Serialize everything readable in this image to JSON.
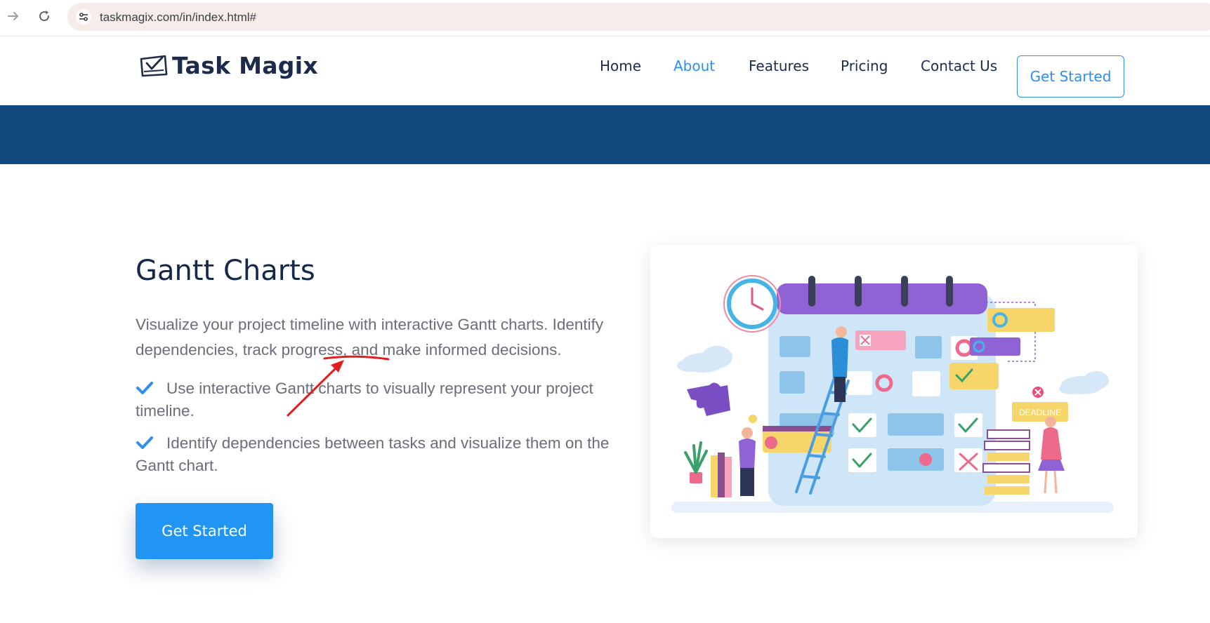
{
  "browser": {
    "url": "taskmagix.com/in/index.html#",
    "back_icon": "arrow-right-icon",
    "reload_icon": "reload-icon",
    "site_info_icon": "tune-icon"
  },
  "header": {
    "logo_text": "Task Magix",
    "logo_icon": "check-board-icon",
    "nav": [
      "Home",
      "About",
      "Features",
      "Pricing",
      "Contact Us"
    ],
    "active_nav": "About",
    "cta_label": "Get Started"
  },
  "colors": {
    "brand_dark": "#1d2b4b",
    "accent": "#2e8ef5",
    "band": "#0f487c",
    "button": "#2195f3",
    "annotation": "#e02020"
  },
  "content": {
    "title": "Gantt Charts",
    "description": "Visualize your project timeline with interactive Gantt charts. Identify dependencies, track progress, and make informed decisions.",
    "features": [
      "Use interactive Gantt charts to visually represent your project timeline.",
      "Identify dependencies between tasks and visualize them on the Gantt chart."
    ],
    "cta_label": "Get Started"
  },
  "illustration": {
    "deadline_label": "DEADLINE"
  }
}
